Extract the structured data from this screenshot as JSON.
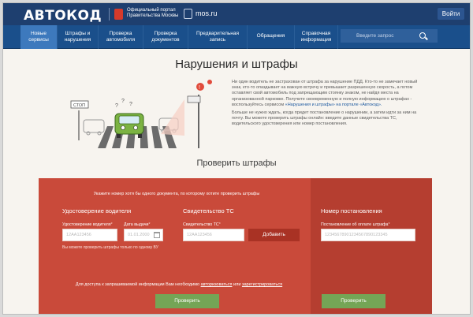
{
  "header": {
    "logo": "АВТОКОД",
    "portal_line1": "Официальный портал",
    "portal_line2": "Правительства Москвы",
    "mos_ru": "mos.ru",
    "login": "Войти"
  },
  "nav": {
    "items": [
      {
        "line1": "Новые",
        "line2": "сервисы",
        "active": true
      },
      {
        "line1": "Штрафы и",
        "line2": "нарушения"
      },
      {
        "line1": "Проверка",
        "line2": "автомобиля"
      },
      {
        "line1": "Проверка",
        "line2": "документов"
      },
      {
        "line1": "Предварительная",
        "line2": "запись"
      },
      {
        "line1": "Обращения",
        "line2": ""
      },
      {
        "line1": "Справочная",
        "line2": "информация"
      }
    ],
    "search_placeholder": "Введите запрос"
  },
  "main": {
    "title": "Нарушения и штрафы",
    "sign_text": "СТОП",
    "intro_p1": "Ни один водитель не застрахован от штрафа за нарушение ПДД. Кто-то не замечает новый знак, кто-то опаздывает на важную встречу и превышает разрешенную скорость, а потом оставляет свой автомобиль под запрещающим стоянку знаком, не найдя места на организованной парковке. Получите своевременную и полную информацию о штрафах - воспользуйтесь сервисом",
    "intro_link": "«Нарушения и штрафы» на портале «Автокод».",
    "intro_p2": "Больше не нужно ждать, когда придет постановление о нарушении, а затем идти за ним на почту. Вы можете проверить штрафы онлайн: введите данные свидетельства ТС, водительского удостоверения или номер постановления.",
    "check_title": "Проверить штрафы"
  },
  "form": {
    "instruction": "Укажите номер хотя бы одного документа, по которому хотите проверить штрафы",
    "license": {
      "title": "Удостоверение водителя",
      "number_label": "Удостоверение водителя",
      "number_placeholder": "12АА123456",
      "date_label": "Дата выдачи",
      "date_placeholder": "01.01.2000",
      "note": "Вы можете проверить штрафы только по одному ВУ"
    },
    "vehicle": {
      "title": "Свидетельство ТС",
      "label": "Свидетельство ТС",
      "placeholder": "12АА123456",
      "add": "Добавить"
    },
    "ruling": {
      "title": "Номер постановления",
      "label": "Постановление об оплате штрафа",
      "placeholder": "12345678901234567890123345"
    },
    "auth_prefix": "Для доступа к запрашиваемой информации Вам необходимо",
    "auth_login": "авторизоваться",
    "auth_or": "или",
    "auth_register": "зарегистрироваться",
    "check_left": "Проверить",
    "check_right": "Проверить"
  },
  "colors": {
    "topbar": "#1e3f6f",
    "nav": "#1a4f8b",
    "nav_active": "#3d79bd",
    "panel": "#c94a3a",
    "panel_dark": "#b53e30",
    "button_green": "#74a556"
  }
}
